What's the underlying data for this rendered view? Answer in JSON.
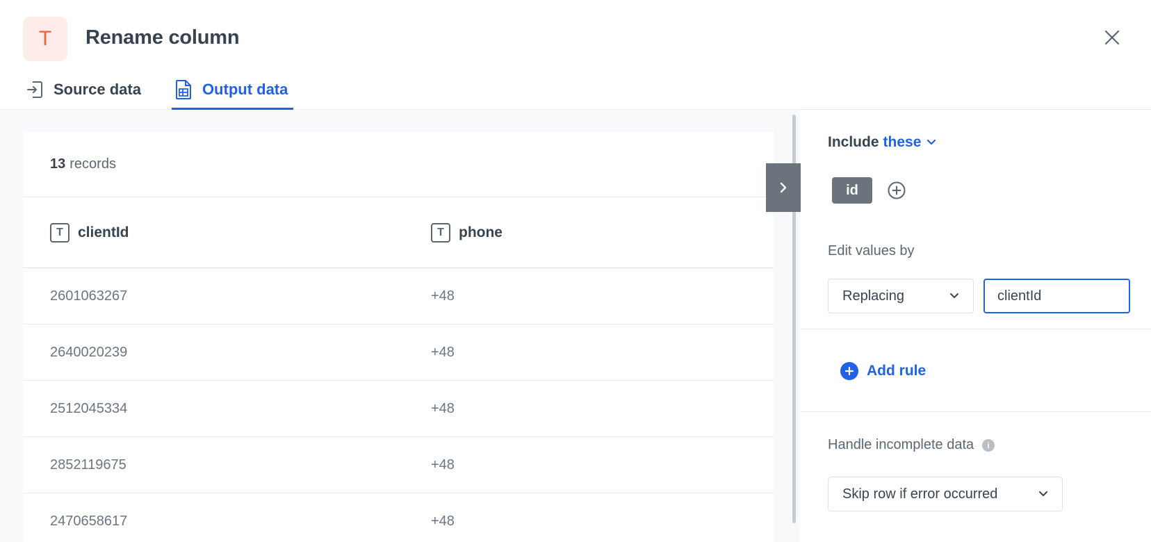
{
  "header": {
    "app_icon_glyph": "T",
    "title": "Rename column",
    "close_icon": "close-icon"
  },
  "tabs": [
    {
      "label": "Source data",
      "icon": "import-icon",
      "active": false
    },
    {
      "label": "Output data",
      "icon": "table-file-icon",
      "active": true
    }
  ],
  "table": {
    "records_count": "13",
    "records_label": "records",
    "columns": [
      {
        "name": "clientId",
        "type_glyph": "T"
      },
      {
        "name": "phone",
        "type_glyph": "T"
      }
    ],
    "rows": [
      {
        "clientId": "2601063267",
        "phone": "+48"
      },
      {
        "clientId": "2640020239",
        "phone": "+48"
      },
      {
        "clientId": "2512045334",
        "phone": "+48"
      },
      {
        "clientId": "2852119675",
        "phone": "+48"
      },
      {
        "clientId": "2470658617",
        "phone": "+48"
      }
    ]
  },
  "panel": {
    "include_label": "Include",
    "include_selector": "these",
    "selected_columns": [
      "id"
    ],
    "edit_label": "Edit values by",
    "edit_mode": "Replacing",
    "replace_value": "clientId",
    "add_rule_label": "Add rule",
    "incomplete_label": "Handle incomplete data",
    "incomplete_option": "Skip row if error occurred"
  },
  "colors": {
    "accent": "#1f62e8",
    "app_icon_bg": "#fdecea",
    "app_icon_fg": "#f0603a",
    "chip_bg": "#6b737c"
  }
}
